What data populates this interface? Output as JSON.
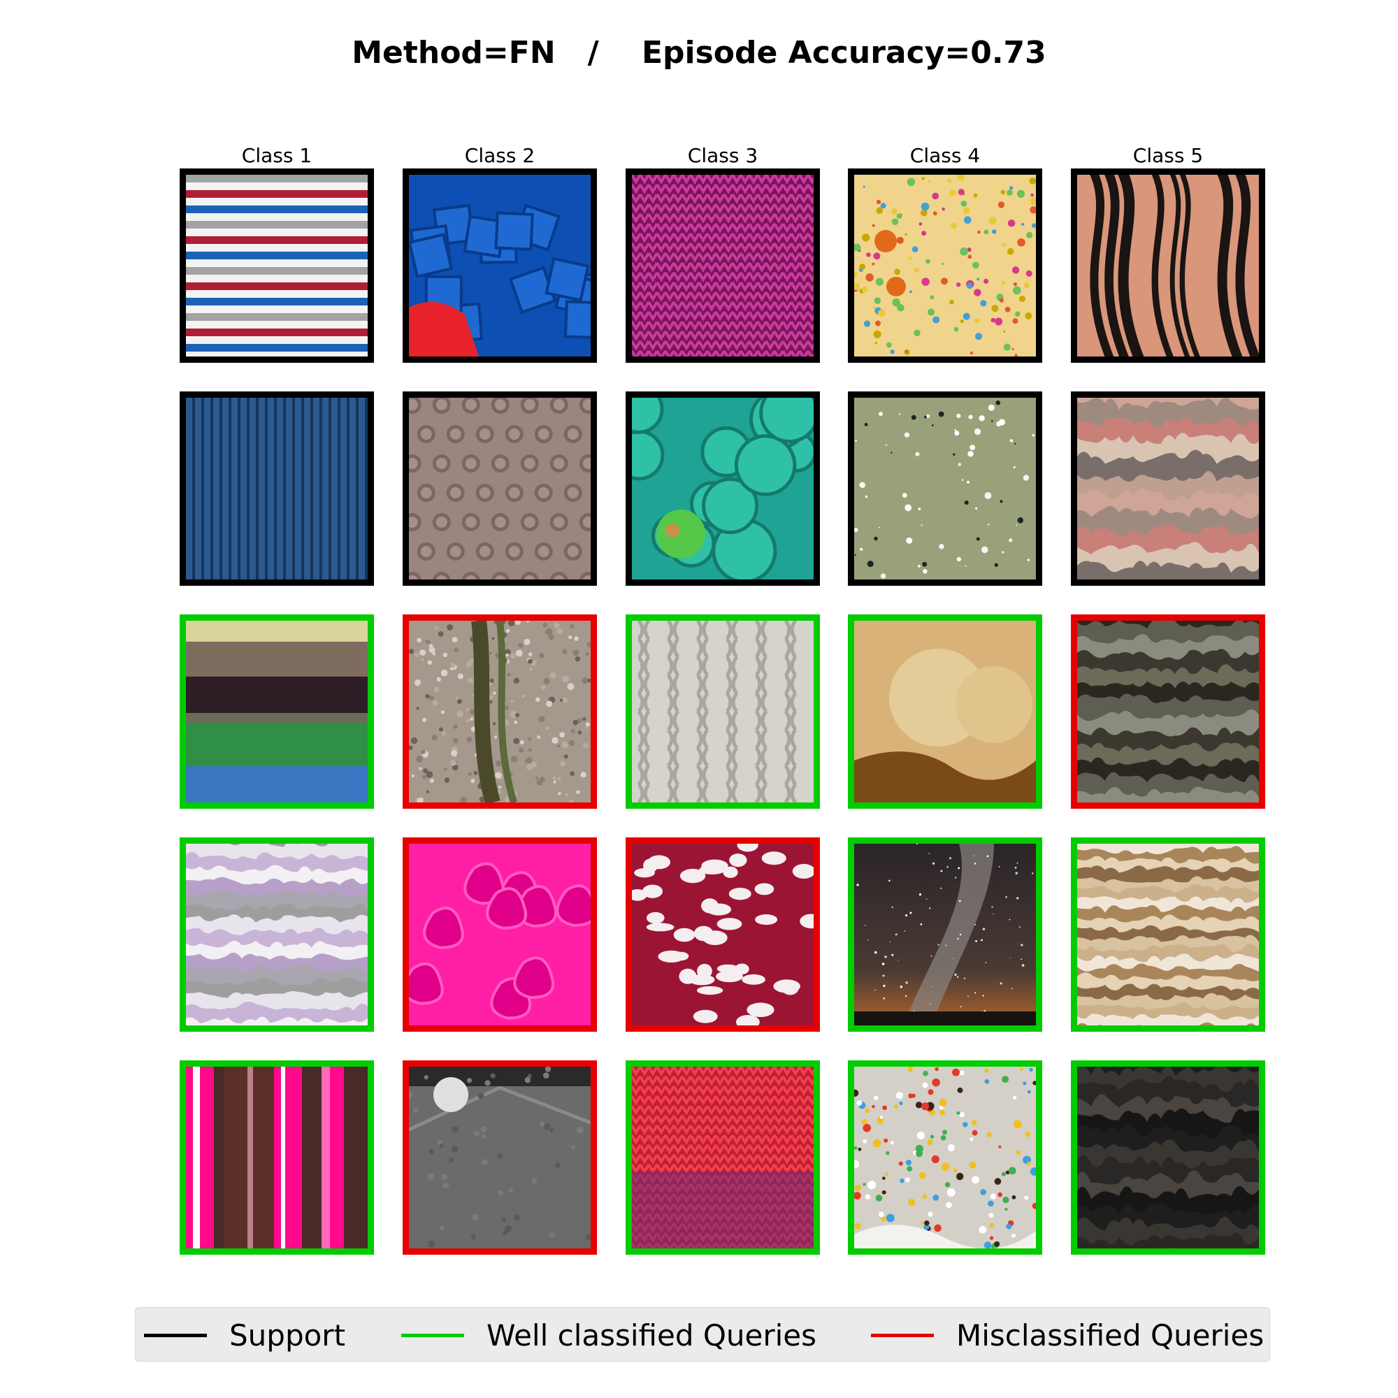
{
  "title": "Method=FN   /    Episode Accuracy=0.73",
  "columns": [
    "Class 1",
    "Class 2",
    "Class 3",
    "Class 4",
    "Class 5"
  ],
  "colors": {
    "support": "#000000",
    "correct": "#00cc00",
    "wrong": "#e60000"
  },
  "legend": [
    {
      "label": "Support",
      "kind": "support"
    },
    {
      "label": "Well classified Queries",
      "kind": "correct"
    },
    {
      "label": "Misclassified Queries",
      "kind": "wrong"
    }
  ],
  "grid": [
    [
      {
        "kind": "support",
        "texture": "red blue grey white horizontal stripes"
      },
      {
        "kind": "support",
        "texture": "blue cubes with red pieces"
      },
      {
        "kind": "support",
        "texture": "magenta knitted wool"
      },
      {
        "kind": "support",
        "texture": "yellow paper with paint splatters"
      },
      {
        "kind": "support",
        "texture": "tan and black striped rock"
      }
    ],
    [
      {
        "kind": "support",
        "texture": "blue vertical pinstripes"
      },
      {
        "kind": "support",
        "texture": "grey studded surface"
      },
      {
        "kind": "support",
        "texture": "teal crochet flowers"
      },
      {
        "kind": "support",
        "texture": "olive speckled surface"
      },
      {
        "kind": "support",
        "texture": "layered pink and grey rock"
      }
    ],
    [
      {
        "kind": "correct",
        "texture": "brown dark green blue wide stripes"
      },
      {
        "kind": "wrong",
        "texture": "tree bark with vines"
      },
      {
        "kind": "correct",
        "texture": "white cable knit"
      },
      {
        "kind": "correct",
        "texture": "golden pastry crust"
      },
      {
        "kind": "wrong",
        "texture": "dark layered rock"
      }
    ],
    [
      {
        "kind": "correct",
        "texture": "grey lilac curved stripes"
      },
      {
        "kind": "wrong",
        "texture": "hot pink embossed fabric"
      },
      {
        "kind": "wrong",
        "texture": "red and white knit pattern"
      },
      {
        "kind": "correct",
        "texture": "milky way night sky"
      },
      {
        "kind": "correct",
        "texture": "tan banded marble"
      }
    ],
    [
      {
        "kind": "correct",
        "texture": "pink brown vertical stripes"
      },
      {
        "kind": "wrong",
        "texture": "grey studded floor"
      },
      {
        "kind": "correct",
        "texture": "red purple knit"
      },
      {
        "kind": "correct",
        "texture": "frosting with sprinkles"
      },
      {
        "kind": "correct",
        "texture": "dark rough rock"
      }
    ]
  ]
}
